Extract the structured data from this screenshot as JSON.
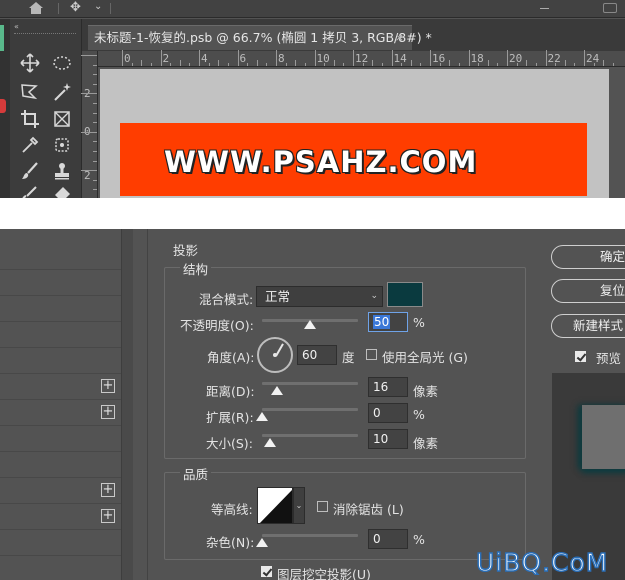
{
  "document_tab": {
    "title": "未标题-1-恢复的.psb @ 66.7% (椭圆 1 拷贝 3, RGB/8#) *",
    "close": "×"
  },
  "rulers": {
    "top_labels": [
      "0",
      "2",
      "4",
      "6",
      "8",
      "10",
      "12",
      "14",
      "16",
      "18",
      "20",
      "22",
      "24"
    ],
    "left_labels": [
      "2",
      "0",
      "2"
    ]
  },
  "canvas": {
    "text": "WWW.PSAHZ.COM",
    "rect_color": "#ff3d00",
    "background_color": "#c2c2c2"
  },
  "toolbar": {
    "collapse_label": "«",
    "tools": [
      "move-tool-icon",
      "elliptical-marquee-icon",
      "polygonal-lasso-icon",
      "magic-wand-icon",
      "crop-tool-icon",
      "frame-tool-icon",
      "eyedropper-icon",
      "patch-tool-icon",
      "brush-icon",
      "stamp-icon",
      "history-brush-icon",
      "eraser-icon"
    ]
  },
  "drop_shadow": {
    "section_title": "投影",
    "structure": {
      "title": "结构",
      "blend_mode_label": "混合模式:",
      "blend_mode_value": "正常",
      "shadow_color": "#0a3a3f",
      "opacity_label": "不透明度(O):",
      "opacity_value": "50",
      "opacity_unit": "%",
      "angle_label": "角度(A):",
      "angle_value": "60",
      "angle_unit": "度",
      "global_light_label": "使用全局光 (G)",
      "global_light_checked": false,
      "distance_label": "距离(D):",
      "distance_value": "16",
      "distance_unit": "像素",
      "spread_label": "扩展(R):",
      "spread_value": "0",
      "spread_unit": "%",
      "size_label": "大小(S):",
      "size_value": "10",
      "size_unit": "像素"
    },
    "quality": {
      "title": "品质",
      "contour_label": "等高线:",
      "anti_alias_label": "消除锯齿 (L)",
      "anti_alias_checked": false,
      "noise_label": "杂色(N):",
      "noise_value": "0",
      "noise_unit": "%"
    },
    "knockout_label": "图层挖空投影(U)",
    "knockout_checked": true
  },
  "dialog_buttons": {
    "ok": "确定",
    "reset": "复位",
    "new_style": "新建样式",
    "preview_label": "预览",
    "preview_checked": true
  },
  "watermark": "UiBQ.CoM"
}
